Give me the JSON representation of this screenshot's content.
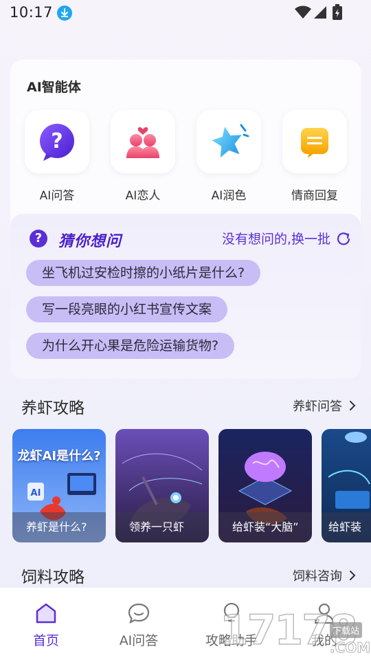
{
  "status": {
    "time": "10:17"
  },
  "agents": {
    "title": "AI智能体",
    "items": [
      {
        "label": "AI问答",
        "icon": "question-bubble-icon"
      },
      {
        "label": "AI恋人",
        "icon": "couple-icon"
      },
      {
        "label": "AI润色",
        "icon": "star-sparkle-icon"
      },
      {
        "label": "情商回复",
        "icon": "message-note-icon"
      }
    ]
  },
  "guess": {
    "title": "猜你想问",
    "refresh_label": "没有想问的,换一批",
    "questions": [
      "坐飞机过安检时擦的小纸片是什么?",
      "写一段亮眼的小红书宣传文案",
      "为什么开心果是危险运输货物?"
    ]
  },
  "shrimp_guide": {
    "title": "养虾攻略",
    "more_label": "养虾问答",
    "cards": [
      {
        "caption": "养虾是什么?",
        "headline": "龙虾AI是什么?"
      },
      {
        "caption": "领养一只虾"
      },
      {
        "caption": "给虾装“大脑”"
      },
      {
        "caption": "给虾装"
      }
    ]
  },
  "feed_guide": {
    "title": "饲料攻略",
    "more_label": "饲料咨询"
  },
  "nav": {
    "items": [
      {
        "label": "首页",
        "active": true
      },
      {
        "label": "AI问答",
        "active": false
      },
      {
        "label": "攻略助手",
        "active": false
      },
      {
        "label": "我的",
        "active": false
      }
    ]
  },
  "watermark": {
    "number": "17178",
    "badge": "下载站",
    "suffix": ".COM"
  },
  "colors": {
    "accent": "#5a2fd6",
    "chip": "#c9bdf6"
  }
}
